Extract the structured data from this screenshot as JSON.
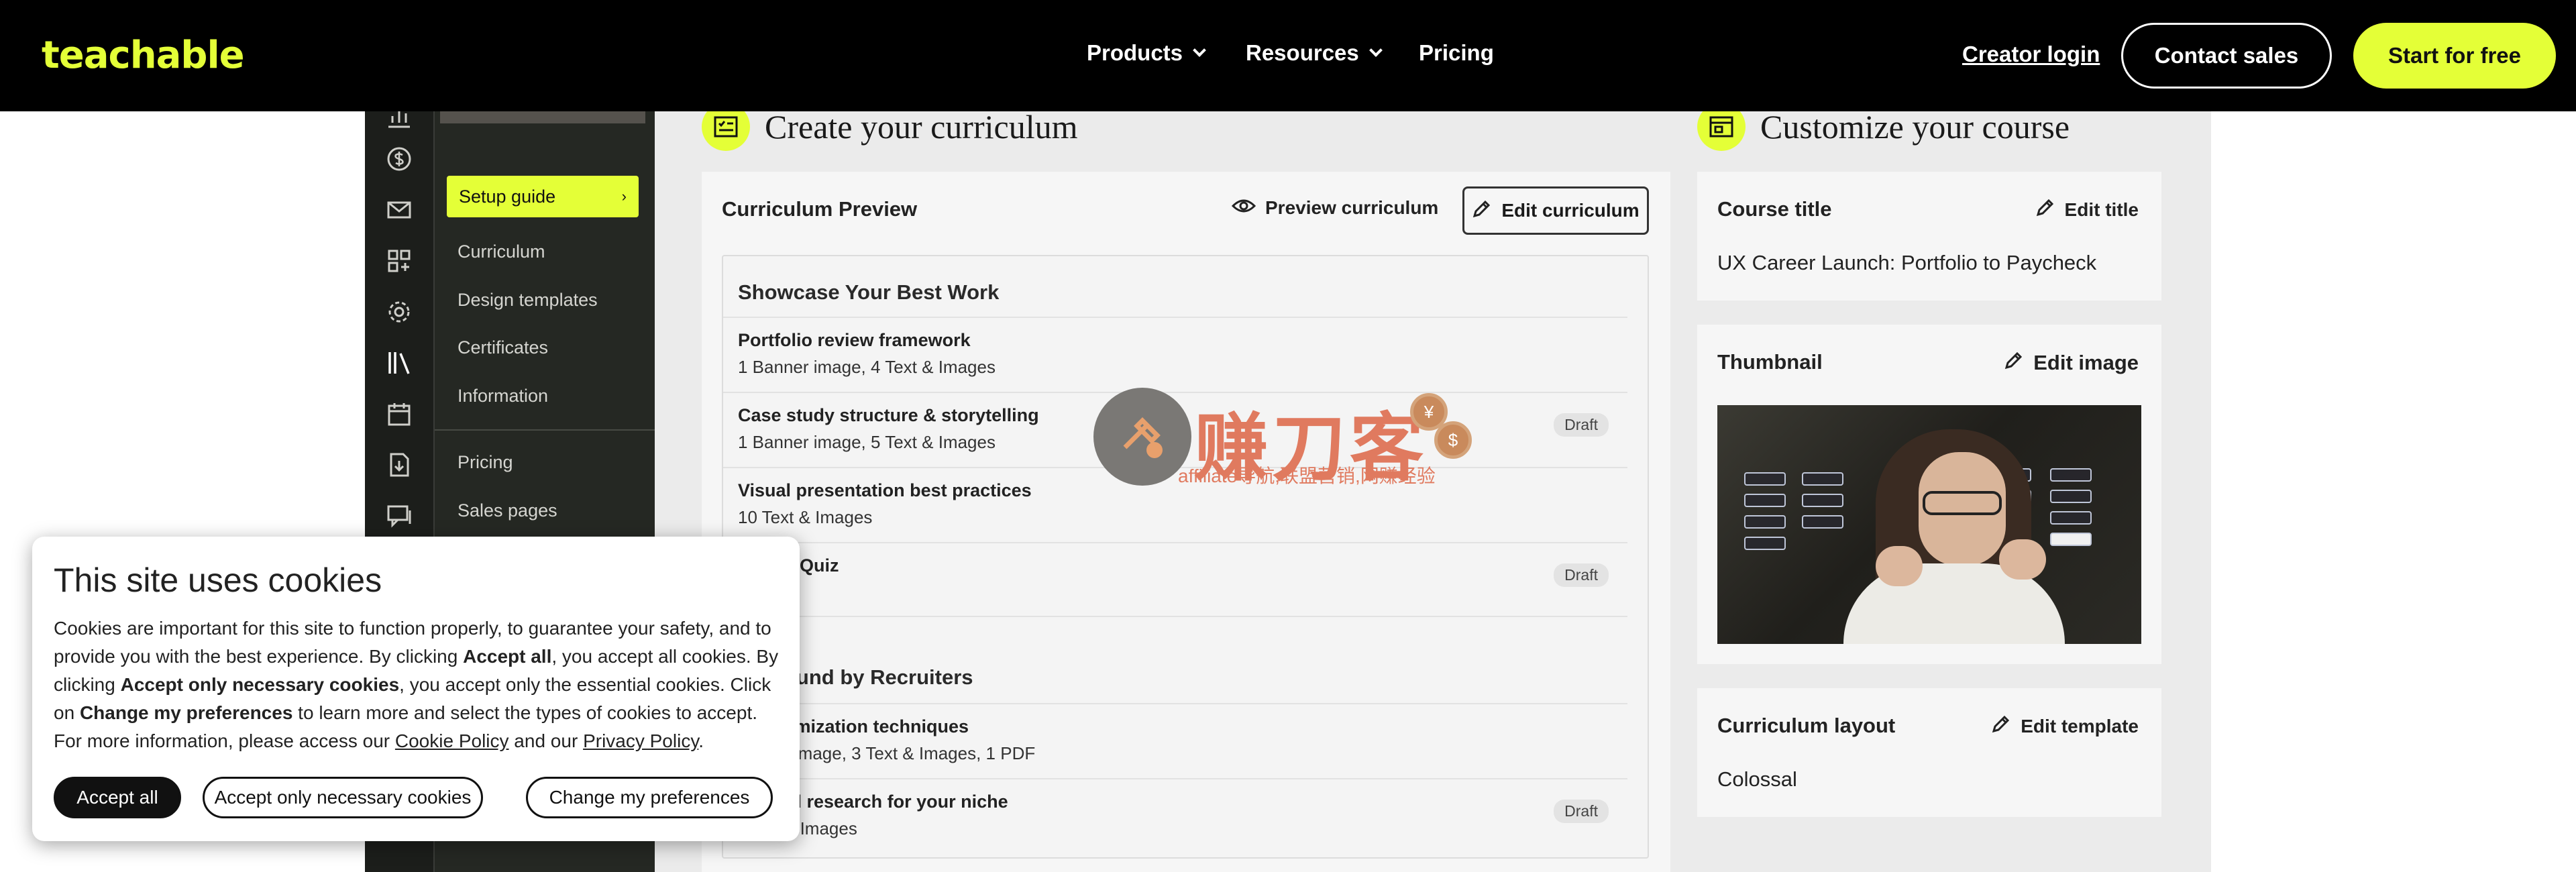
{
  "header": {
    "logo": "teachable",
    "nav": [
      {
        "label": "Products"
      },
      {
        "label": "Resources"
      },
      {
        "label": "Pricing"
      }
    ],
    "login": "Creator login",
    "contact": "Contact sales",
    "cta": "Start for free"
  },
  "sidebar": {
    "active": "Setup guide",
    "items": [
      "Curriculum",
      "Design templates",
      "Certificates",
      "Information",
      "Pricing",
      "Sales pages"
    ]
  },
  "curriculum_section": {
    "title": "Create your curriculum",
    "panel_title": "Curriculum Preview",
    "preview_label": "Preview curriculum",
    "edit_label": "Edit curriculum",
    "sections": [
      {
        "name": "Showcase Your Best Work",
        "lessons": [
          {
            "title": "Portfolio review framework",
            "sub": "1 Banner image, 4 Text & Images",
            "badge": ""
          },
          {
            "title": "Case study structure & storytelling",
            "sub": "1 Banner image, 5 Text & Images",
            "badge": "Draft"
          },
          {
            "title": "Visual presentation best practices",
            "sub": "10 Text & Images",
            "badge": ""
          },
          {
            "title": "o Quiz",
            "sub": "",
            "badge": "Draft"
          }
        ]
      },
      {
        "name": "ound by Recruiters",
        "lessons": [
          {
            "title": "timization techniques",
            "sub": "r image, 3 Text & Images, 1 PDF",
            "badge": ""
          },
          {
            "title": "rd research for your niche",
            "sub": "& Images",
            "badge": "Draft"
          }
        ]
      }
    ]
  },
  "customize_section": {
    "title": "Customize your course",
    "course_title_label": "Course title",
    "edit_title": "Edit title",
    "course_title_value": "UX Career Launch: Portfolio to Paycheck",
    "thumbnail_label": "Thumbnail",
    "edit_image": "Edit image",
    "layout_label": "Curriculum layout",
    "edit_template": "Edit template",
    "layout_value": "Colossal"
  },
  "watermark": {
    "big": "赚刀客",
    "small": "affiliate导航,联盟营销,网赚经验"
  },
  "cookie": {
    "title": "This site uses cookies",
    "body_1": "Cookies are important for this site to function properly, to guarantee your safety, and to provide you with the best experience. By clicking ",
    "bold_1": "Accept all",
    "body_2": ", you accept all cookies. By clicking ",
    "bold_2": "Accept only necessary cookies",
    "body_3": ", you accept only the essential cookies. Click on ",
    "bold_3": "Change my preferences",
    "body_4": " to learn more and select the types of cookies to accept. For more information, please access our ",
    "link_1": "Cookie Policy",
    "body_5": " and our ",
    "link_2": "Privacy Policy",
    "body_6": ".",
    "accept_all": "Accept all",
    "accept_necessary": "Accept only necessary cookies",
    "change_prefs": "Change my preferences"
  },
  "colors": {
    "brand": "#e4ff37",
    "header_bg": "#000000",
    "sidebar_bg": "#252823"
  }
}
